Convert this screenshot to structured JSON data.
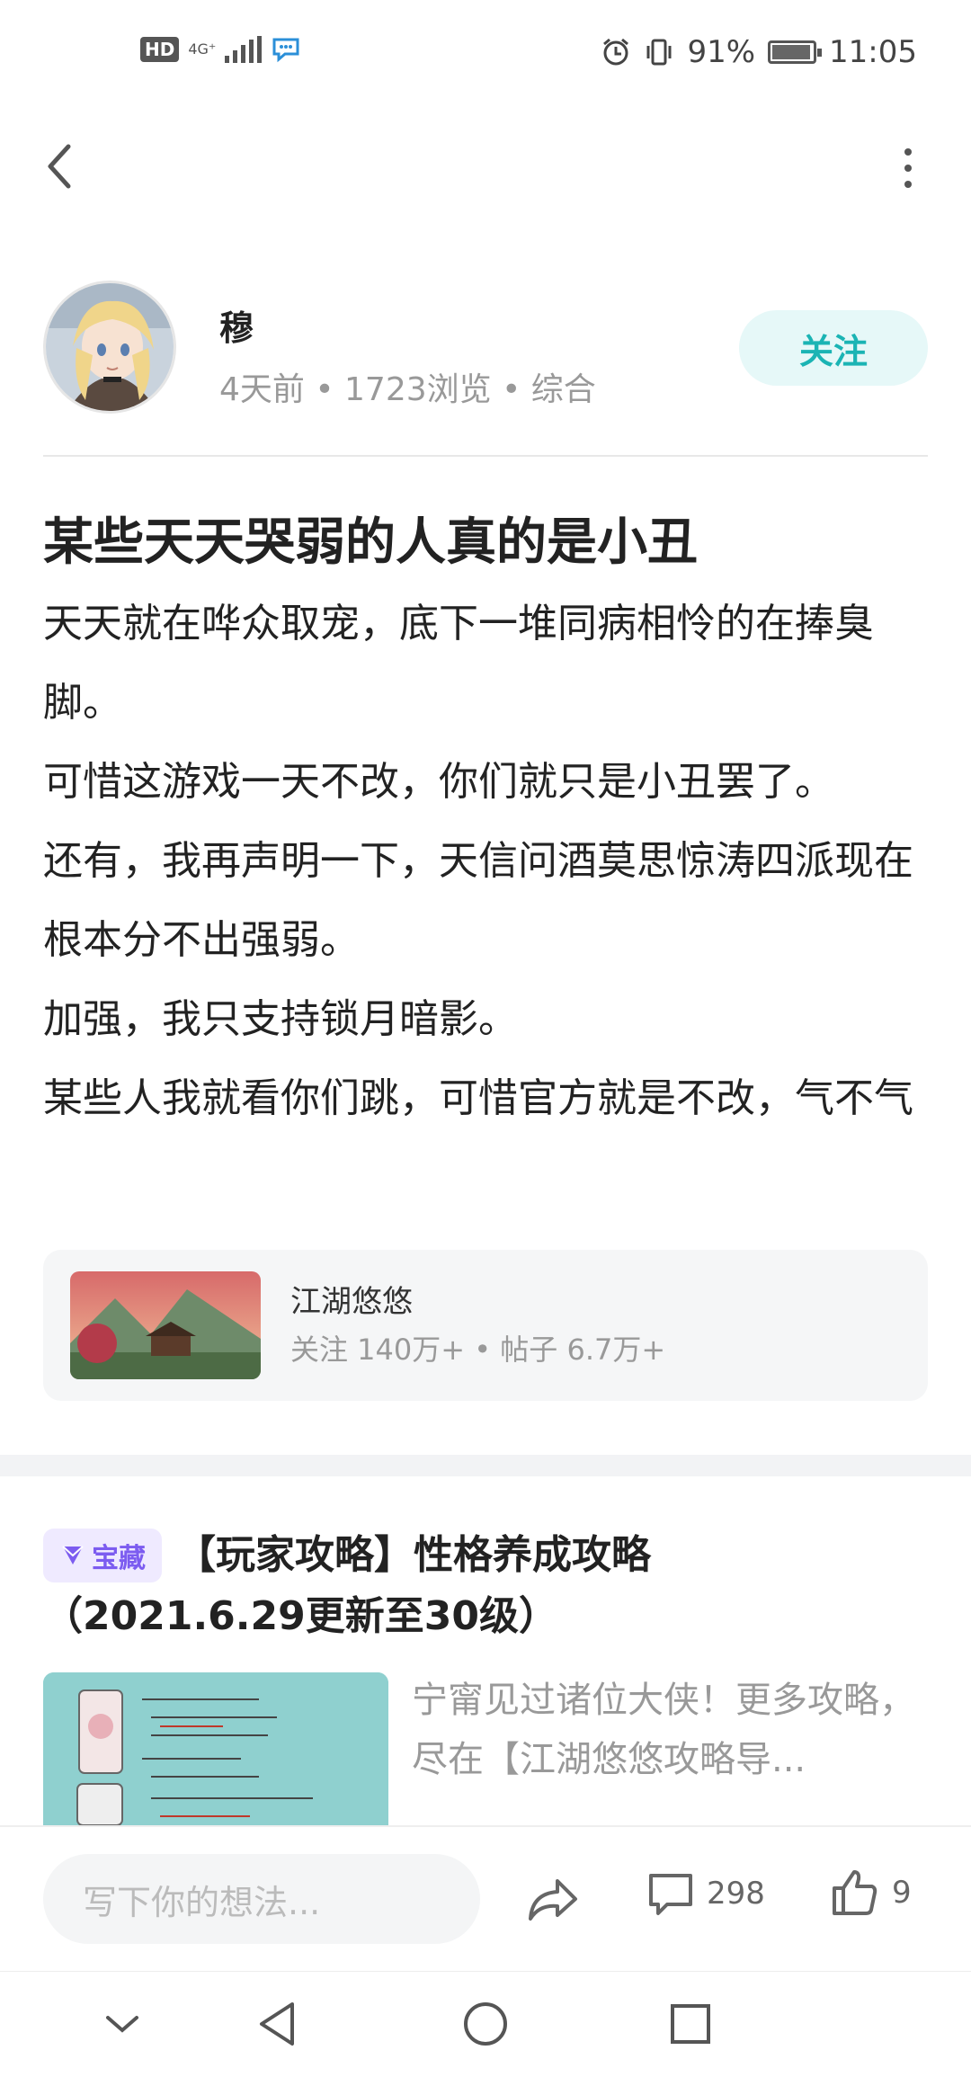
{
  "status_bar": {
    "hd": "HD",
    "network": "4G⁺",
    "battery_level": 0.91,
    "battery_text": "91%",
    "time": "11:05"
  },
  "nav": {
    "back_icon": "chevron-left-icon",
    "more_icon": "more-vertical-icon"
  },
  "author": {
    "name": "穆",
    "meta": "4天前 • 1723浏览 • 综合",
    "follow_label": "关注"
  },
  "post": {
    "title": "某些天天哭弱的人真的是小丑",
    "paragraphs": [
      "天天就在哗众取宠，底下一堆同病相怜的在捧臭脚。",
      "可惜这游戏一天不改，你们就只是小丑罢了。",
      "还有，我再声明一下，天信问酒莫思惊涛四派现在根本分不出强弱。",
      "加强，我只支持锁月暗影。",
      "某些人我就看你们跳，可惜官方就是不改，气不气"
    ]
  },
  "game_card": {
    "name": "江湖悠悠",
    "stats": "关注 140万+ • 帖子 6.7万+"
  },
  "recommended": {
    "badge": "宝藏",
    "title_line1": "【玩家攻略】性格养成攻略",
    "title_line2": "（2021.6.29更新至30级）",
    "excerpt": "宁甯见过诸位大侠！更多攻略，尽在【江湖悠悠攻略导..."
  },
  "bottom_bar": {
    "comment_placeholder": "写下你的想法...",
    "comment_count": "298",
    "like_count": "9"
  },
  "colors": {
    "accent": "#1bb4b4",
    "badge_purple": "#7c5cf0"
  }
}
